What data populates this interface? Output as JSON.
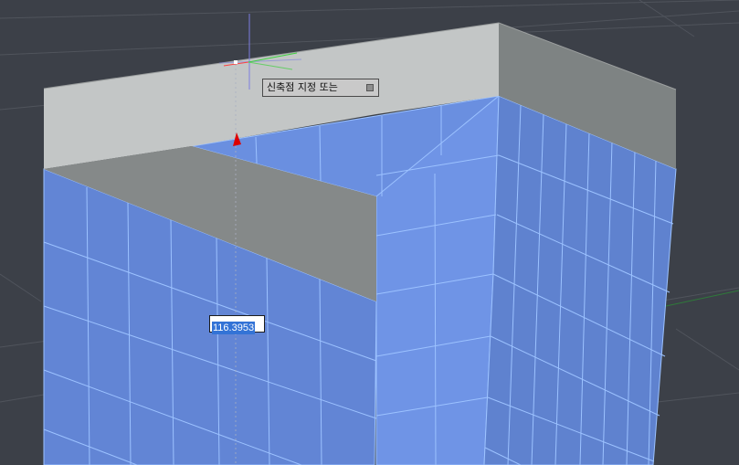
{
  "prompt": {
    "tooltip_text": "신축점 지정 또는",
    "options_icon": "down-arrow-options-icon"
  },
  "dynamic_input": {
    "value": "116.3953"
  },
  "colors": {
    "background": "#3c4048",
    "grid_line": "#50545c",
    "selection_face": "#6a8fe0",
    "selection_edge": "#9cc2ff",
    "solid_top": "#c3c6c6",
    "solid_side": "#8b8f8f",
    "crosshair": "#7d7de0",
    "axis_x": "#ff4040",
    "axis_y": "#40d040",
    "grip": "#dd0000"
  }
}
